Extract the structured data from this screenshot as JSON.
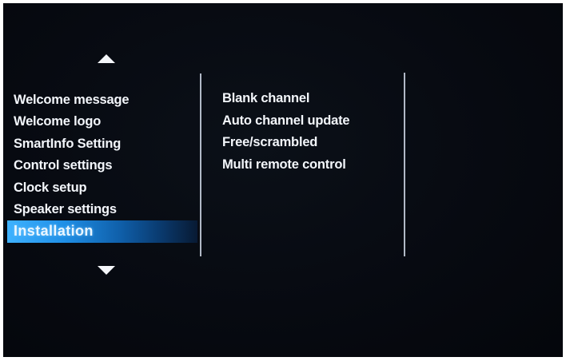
{
  "menu": {
    "items": [
      {
        "label": "Welcome message"
      },
      {
        "label": "Welcome logo"
      },
      {
        "label": "SmartInfo Setting"
      },
      {
        "label": "Control settings"
      },
      {
        "label": "Clock setup"
      },
      {
        "label": "Speaker settings"
      },
      {
        "label": "Installation",
        "selected": true
      }
    ],
    "scroll_up_icon": "triangle-up-icon",
    "scroll_down_icon": "triangle-down-icon"
  },
  "submenu": {
    "items": [
      {
        "label": "Blank channel"
      },
      {
        "label": "Auto channel update"
      },
      {
        "label": "Free/scrambled"
      },
      {
        "label": "Multi remote control"
      }
    ]
  },
  "colors": {
    "background": "#070a11",
    "text": "#f3f6fb",
    "highlight": "#1f8fe6",
    "divider": "#cfd8e6"
  }
}
